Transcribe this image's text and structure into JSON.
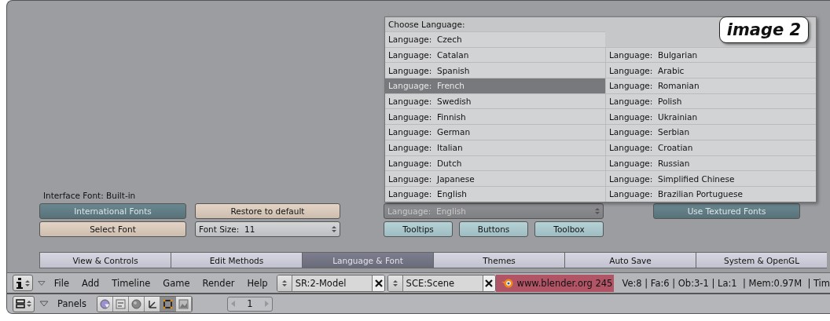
{
  "language_menu": {
    "title": "Choose Language:",
    "left": [
      {
        "label": "Language:  Czech",
        "selected": false
      },
      {
        "label": "Language:  Catalan",
        "selected": false
      },
      {
        "label": "Language:  Spanish",
        "selected": false
      },
      {
        "label": "Language:  French",
        "selected": true
      },
      {
        "label": "Language:  Swedish",
        "selected": false
      },
      {
        "label": "Language:  Finnish",
        "selected": false
      },
      {
        "label": "Language:  German",
        "selected": false
      },
      {
        "label": "Language:  Italian",
        "selected": false
      },
      {
        "label": "Language:  Dutch",
        "selected": false
      },
      {
        "label": "Language:  Japanese",
        "selected": false
      },
      {
        "label": "Language:  English",
        "selected": false
      }
    ],
    "right": [
      {
        "label": "Language:  Bulgarian",
        "selected": false
      },
      {
        "label": "Language:  Arabic",
        "selected": false
      },
      {
        "label": "Language:  Romanian",
        "selected": false
      },
      {
        "label": "Language:  Polish",
        "selected": false
      },
      {
        "label": "Language:  Ukrainian",
        "selected": false
      },
      {
        "label": "Language:  Serbian",
        "selected": false
      },
      {
        "label": "Language:  Croatian",
        "selected": false
      },
      {
        "label": "Language:  Russian",
        "selected": false
      },
      {
        "label": "Language:  Simplified Chinese",
        "selected": false
      },
      {
        "label": "Language:  Brazilian Portuguese",
        "selected": false
      }
    ]
  },
  "badge": "image 2",
  "font_panel": {
    "interface_font": "Interface Font: Built-in",
    "international_fonts": {
      "label": "International Fonts",
      "on": true
    },
    "restore_button": "Restore to default",
    "select_font_button": "Select Font",
    "font_size": {
      "label": "Font Size:  11"
    },
    "language_field": {
      "value": "Language:  English",
      "disabled": true
    },
    "use_textured_fonts": {
      "label": "Use Textured Fonts",
      "on": true
    },
    "toggles": [
      {
        "label": "Tooltips",
        "on": true
      },
      {
        "label": "Buttons",
        "on": true
      },
      {
        "label": "Toolbox",
        "on": true
      }
    ]
  },
  "tabs": [
    {
      "label": "View & Controls",
      "selected": false
    },
    {
      "label": "Edit Methods",
      "selected": false
    },
    {
      "label": "Language & Font",
      "selected": true
    },
    {
      "label": "Themes",
      "selected": false
    },
    {
      "label": "Auto Save",
      "selected": false
    },
    {
      "label": "System & OpenGL",
      "selected": false
    }
  ],
  "header": {
    "menus": [
      "File",
      "Add",
      "Timeline",
      "Game",
      "Render",
      "Help"
    ],
    "screen_field": "SR:2-Model",
    "scene_field": "SCE:Scene",
    "version": "www.blender.org 245",
    "stats": "Ve:8 | Fa:6 | Ob:3-1 | La:1  | Mem:0.97M  | Tim"
  },
  "buttons_header": {
    "menu": "Panels",
    "panel_icons": [
      {
        "kind": "logic",
        "selected": false
      },
      {
        "kind": "script",
        "selected": false
      },
      {
        "kind": "shading",
        "selected": false
      },
      {
        "kind": "object",
        "selected": false
      },
      {
        "kind": "editing",
        "selected": true
      },
      {
        "kind": "scene",
        "selected": false
      }
    ],
    "frame": "1"
  }
}
